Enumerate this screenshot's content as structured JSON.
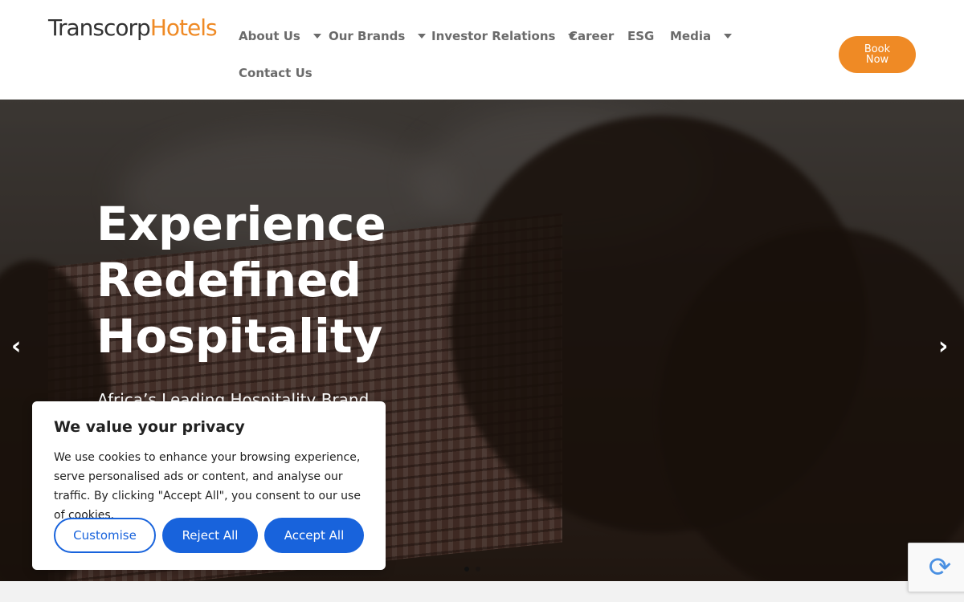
{
  "header": {
    "logo_part1": "Transcorp",
    "logo_part2": "Hotels",
    "nav": [
      {
        "label": "About Us",
        "dropdown": true
      },
      {
        "label": "Our Brands",
        "dropdown": true
      },
      {
        "label": "Investor Relations",
        "dropdown": true
      },
      {
        "label": "Career",
        "dropdown": false
      },
      {
        "label": "ESG",
        "dropdown": false
      },
      {
        "label": "Media",
        "dropdown": true
      },
      {
        "label": "Contact Us",
        "dropdown": false
      }
    ],
    "book_now": "Book Now"
  },
  "hero": {
    "title": "Experience Redefined Hospitality",
    "subtitle": "Africa’s Leading Hospitality Brand",
    "prev_icon": "chevron-left-icon",
    "next_icon": "chevron-right-icon"
  },
  "cookie": {
    "title": "We value your privacy",
    "text": "We use cookies to enhance your browsing experience, serve personalised ads or content, and analyse our traffic. By clicking \"Accept All\", you consent to our use of cookies.",
    "customise": "Customise",
    "reject": "Reject All",
    "accept": "Accept All"
  },
  "colors": {
    "accent": "#ef8a25",
    "button_blue": "#1863dc"
  }
}
